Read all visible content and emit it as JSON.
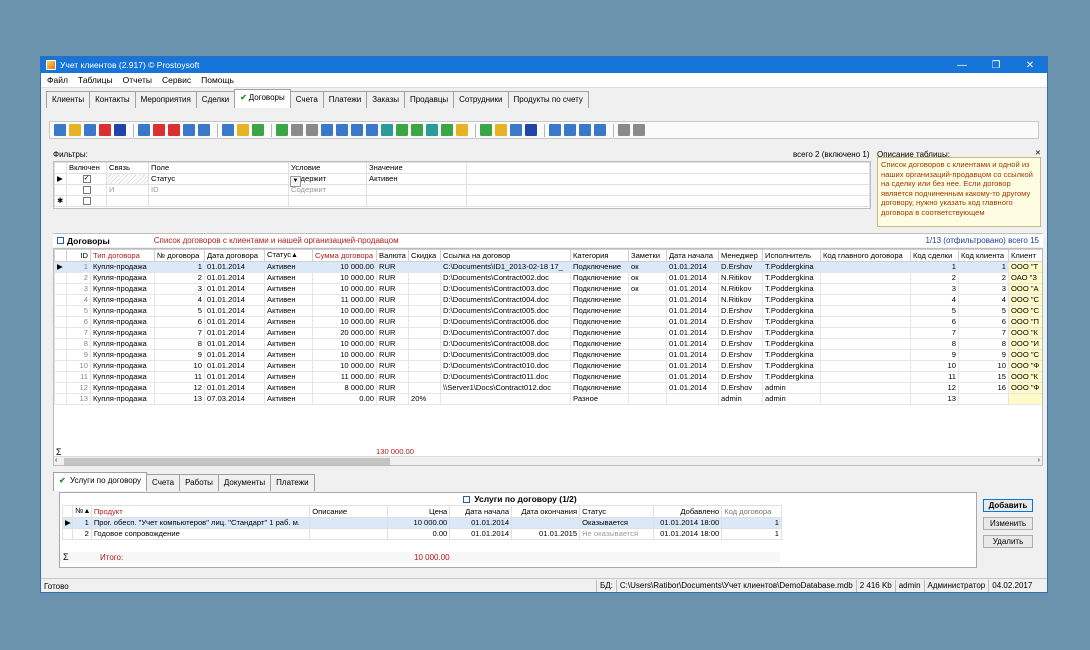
{
  "window": {
    "title": "Учет клиентов (2.917) © Prostoysoft",
    "min": "—",
    "restore": "❐",
    "close": "✕"
  },
  "menu": [
    "Файл",
    "Таблицы",
    "Отчеты",
    "Сервис",
    "Помощь"
  ],
  "tabs": [
    "Клиенты",
    "Контакты",
    "Мероприятия",
    "Сделки",
    "Договоры",
    "Счета",
    "Платежи",
    "Заказы",
    "Продавцы",
    "Сотрудники",
    "Продукты по счету"
  ],
  "filters": {
    "label": "Фильтры:",
    "count": "всего 2 (включено 1)",
    "columns": [
      "Включен",
      "Связь",
      "Поле",
      "Условие",
      "Значение"
    ],
    "rows": [
      {
        "checked": true,
        "link": "",
        "field": "Статус",
        "cond": "Содержит",
        "value": "Активен"
      },
      {
        "checked": false,
        "link": "И",
        "field": "ID",
        "cond": "Содержит",
        "value": ""
      }
    ]
  },
  "description": {
    "label": "Описание таблицы:",
    "text": "Список договоров с клиентами и одной из наших организаций-продавцом со ссылкой на сделку или без нее. Если договор является подчиненным какому-то другому договору, нужно указать код главного договора в соответствующем"
  },
  "contracts": {
    "title": "Договоры",
    "subtitle": "Список договоров с клиентами и нашей организацией-продавцом",
    "count": "1/13 (отфильтровано) всего 15",
    "columns": [
      "ID",
      "Тип договора",
      "№ договора",
      "Дата договора",
      "Статус",
      "Сумма договора",
      "Валюта",
      "Скидка",
      "Ссылка на договор",
      "Категория",
      "Заметки",
      "Дата начала",
      "Менеджер",
      "Исполнитель",
      "Код главного договора",
      "Код сделки",
      "Код клиента",
      "Клиент"
    ],
    "rows": [
      [
        "1",
        "Купля-продажа",
        "1",
        "01.01.2014",
        "Активен",
        "10 000.00",
        "RUR",
        "",
        "C:\\Documents\\ID1_2013-02-18 17_",
        "Подключение",
        "ок",
        "01.01.2014",
        "D.Ershov",
        "T.Poddergkina",
        "",
        "1",
        "1",
        "ООО \"Т"
      ],
      [
        "2",
        "Купля-продажа",
        "2",
        "01.01.2014",
        "Активен",
        "10 000.00",
        "RUR",
        "",
        "D:\\Documents\\Contract002.doc",
        "Подключение",
        "ок",
        "01.01.2014",
        "N.Ritikov",
        "T.Poddergkina",
        "",
        "2",
        "2",
        "ОАО \"З"
      ],
      [
        "3",
        "Купля-продажа",
        "3",
        "01.01.2014",
        "Активен",
        "10 000.00",
        "RUR",
        "",
        "D:\\Documents\\Contract003.doc",
        "Подключение",
        "ок",
        "01.01.2014",
        "N.Ritikov",
        "T.Poddergkina",
        "",
        "3",
        "3",
        "ООО \"А"
      ],
      [
        "4",
        "Купля-продажа",
        "4",
        "01.01.2014",
        "Активен",
        "11 000.00",
        "RUR",
        "",
        "D:\\Documents\\Contract004.doc",
        "Подключение",
        "",
        "01.01.2014",
        "N.Ritikov",
        "T.Poddergkina",
        "",
        "4",
        "4",
        "ООО \"С"
      ],
      [
        "5",
        "Купля-продажа",
        "5",
        "01.01.2014",
        "Активен",
        "10 000.00",
        "RUR",
        "",
        "D:\\Documents\\Contract005.doc",
        "Подключение",
        "",
        "01.01.2014",
        "D.Ershov",
        "T.Poddergkina",
        "",
        "5",
        "5",
        "ООО \"С"
      ],
      [
        "6",
        "Купля-продажа",
        "6",
        "01.01.2014",
        "Активен",
        "10 000.00",
        "RUR",
        "",
        "D:\\Documents\\Contract006.doc",
        "Подключение",
        "",
        "01.01.2014",
        "D.Ershov",
        "T.Poddergkina",
        "",
        "6",
        "6",
        "ООО \"П"
      ],
      [
        "7",
        "Купля-продажа",
        "7",
        "01.01.2014",
        "Активен",
        "20 000.00",
        "RUR",
        "",
        "D:\\Documents\\Contract007.doc",
        "Подключение",
        "",
        "01.01.2014",
        "D.Ershov",
        "T.Poddergkina",
        "",
        "7",
        "7",
        "ООО \"К"
      ],
      [
        "8",
        "Купля-продажа",
        "8",
        "01.01.2014",
        "Активен",
        "10 000.00",
        "RUR",
        "",
        "D:\\Documents\\Contract008.doc",
        "Подключение",
        "",
        "01.01.2014",
        "D.Ershov",
        "T.Poddergkina",
        "",
        "8",
        "8",
        "ООО \"И"
      ],
      [
        "9",
        "Купля-продажа",
        "9",
        "01.01.2014",
        "Активен",
        "10 000.00",
        "RUR",
        "",
        "D:\\Documents\\Contract009.doc",
        "Подключение",
        "",
        "01.01.2014",
        "D.Ershov",
        "T.Poddergkina",
        "",
        "9",
        "9",
        "ООО \"С"
      ],
      [
        "10",
        "Купля-продажа",
        "10",
        "01.01.2014",
        "Активен",
        "10 000.00",
        "RUR",
        "",
        "D:\\Documents\\Contract010.doc",
        "Подключение",
        "",
        "01.01.2014",
        "D.Ershov",
        "T.Poddergkina",
        "",
        "10",
        "10",
        "ООО \"Ф"
      ],
      [
        "11",
        "Купля-продажа",
        "11",
        "01.01.2014",
        "Активен",
        "11 000.00",
        "RUR",
        "",
        "D:\\Documents\\Contract011.doc",
        "Подключение",
        "",
        "01.01.2014",
        "D.Ershov",
        "T.Poddergkina",
        "",
        "11",
        "15",
        "ООО \"К"
      ],
      [
        "12",
        "Купля-продажа",
        "12",
        "01.01.2014",
        "Активен",
        "8 000.00",
        "RUR",
        "",
        "\\\\Server1\\Docs\\Contract012.doc",
        "Подключение",
        "",
        "01.01.2014",
        "D.Ershov",
        "admin",
        "",
        "12",
        "16",
        "ООО \"Ф"
      ],
      [
        "13",
        "Купля-продажа",
        "13",
        "07.03.2014",
        "Активен",
        "0.00",
        "RUR",
        "20%",
        "",
        "Разное",
        "",
        "",
        "admin",
        "admin",
        "",
        "13",
        "",
        ""
      ]
    ],
    "sum_symbol": "Σ",
    "total": "130 000.00"
  },
  "subtabs": [
    "Услуги по договору",
    "Счета",
    "Работы",
    "Документы",
    "Платежи"
  ],
  "services": {
    "title": "Услуги по договору (1/2)",
    "columns": [
      "№",
      "Продукт",
      "Описание",
      "Цена",
      "Дата начала",
      "Дата окончания",
      "Статус",
      "Добавлено",
      "Код договора"
    ],
    "rows": [
      [
        "1",
        "Прог. обесп. \"Учет компьютеров\" лиц. \"Стандарт\" 1 раб. м.",
        "",
        "10 000.00",
        "01.01.2014",
        "",
        "Оказывается",
        "01.01.2014 18:00",
        "1"
      ],
      [
        "2",
        "Годовое сопровождение",
        "",
        "0.00",
        "01.01.2014",
        "01.01.2015",
        "Не оказывается",
        "01.01.2014 18:00",
        "1"
      ]
    ],
    "total_label": "Итого:",
    "total": "10 000.00"
  },
  "buttons": {
    "add": "Добавить",
    "edit": "Изменить",
    "delete": "Удалить"
  },
  "status": {
    "ready": "Готово",
    "db_label": "БД:",
    "db_path": "C:\\Users\\Ratibor\\Documents\\Учет клиентов\\DemoDatabase.mdb",
    "size": "2 416 Kb",
    "user": "admin",
    "role": "Администратор",
    "date": "04.02.2017"
  }
}
